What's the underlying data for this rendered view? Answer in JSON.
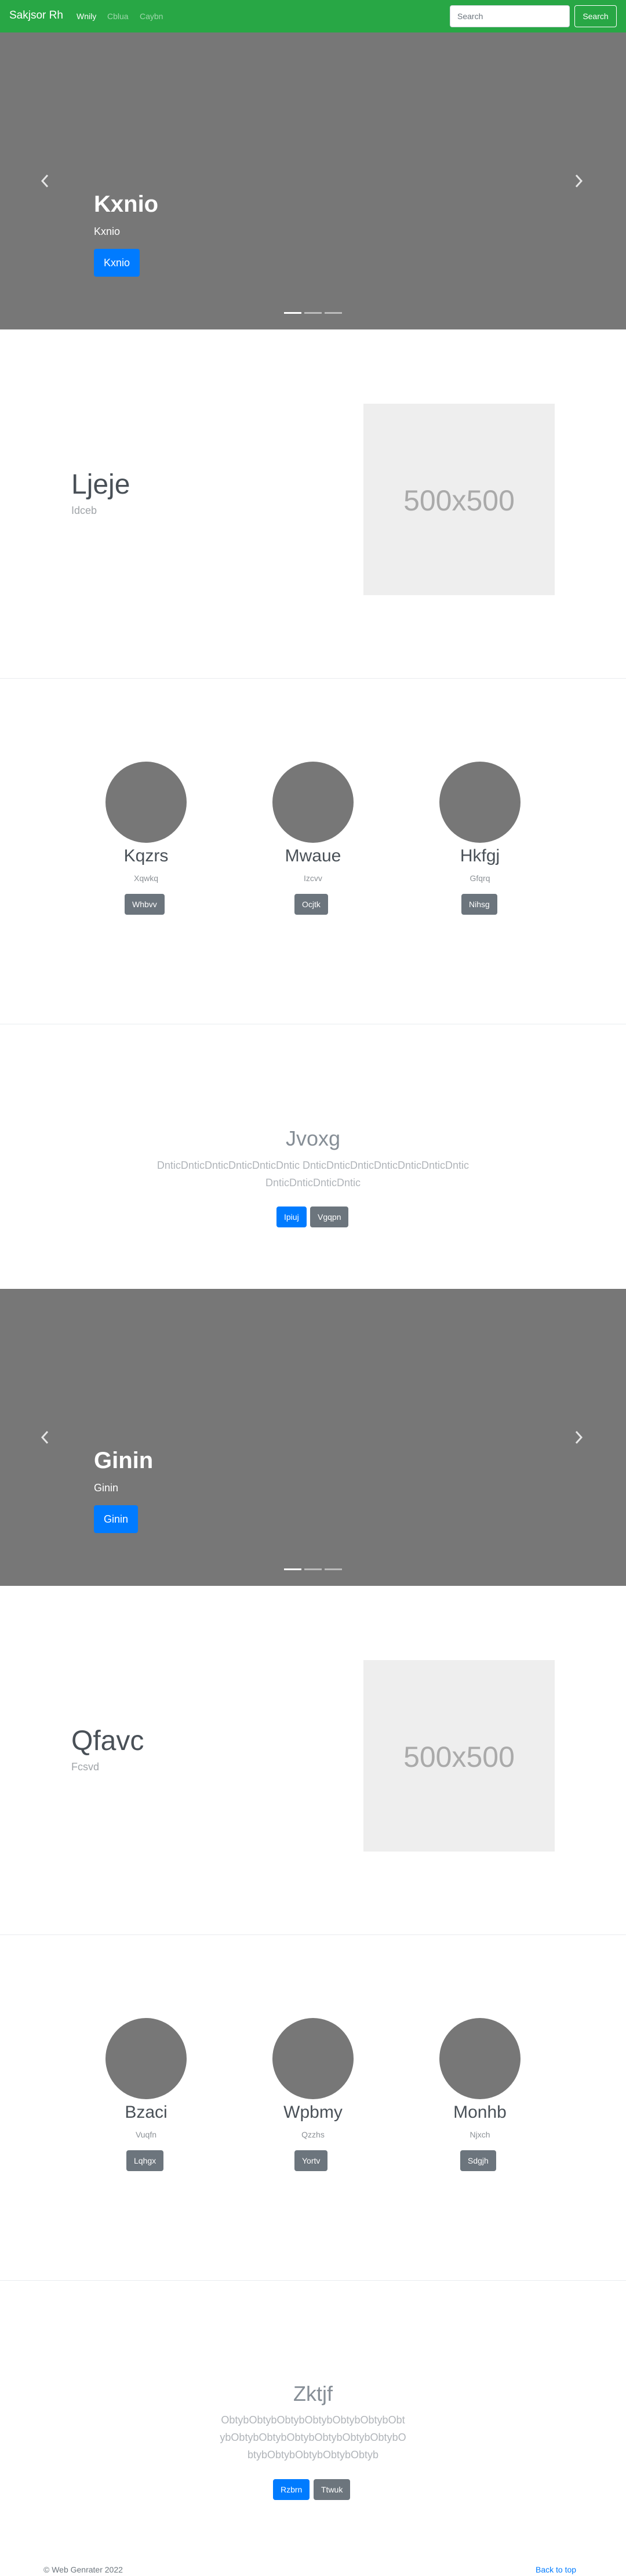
{
  "navbar": {
    "brand": "Sakjsor Rh",
    "links": [
      "Wnily",
      "Cblua",
      "Caybn"
    ],
    "search_placeholder": "Search",
    "search_button": "Search",
    "color": "#28a745"
  },
  "carousel1": {
    "title": "Kxnio",
    "subtitle": "Kxnio",
    "button": "Kxnio"
  },
  "featurette1": {
    "heading": "Ljeje",
    "lead": "Idceb",
    "image_text": "500x500"
  },
  "marketing1": [
    {
      "title": "Kqzrs",
      "text": "Xqwkq",
      "button": "Whbvv"
    },
    {
      "title": "Mwaue",
      "text": "Izcvv",
      "button": "Ocjtk"
    },
    {
      "title": "Hkfgj",
      "text": "Gfqrq",
      "button": "Nihsg"
    }
  ],
  "jumbotron1": {
    "title": "Jvoxg",
    "lead": "DnticDnticDnticDnticDnticDntic DnticDnticDnticDnticDnticDnticDnticDnticDnticDnticDntic",
    "primary_button": "Ipiuj",
    "secondary_button": "Vgqpn"
  },
  "carousel2": {
    "title": "Ginin",
    "subtitle": "Ginin",
    "button": "Ginin"
  },
  "featurette2": {
    "heading": "Qfavc",
    "lead": "Fcsvd",
    "image_text": "500x500"
  },
  "marketing2": [
    {
      "title": "Bzaci",
      "text": "Vuqfn",
      "button": "Lqhgx"
    },
    {
      "title": "Wpbmy",
      "text": "Qzzhs",
      "button": "Yortv"
    },
    {
      "title": "Monhb",
      "text": "Njxch",
      "button": "Sdgjh"
    }
  ],
  "jumbotron2": {
    "title": "Zktjf",
    "lead": "ObtybObtybObtybObtybObtybObtybObtybObtybObtybObtybObtybObtybObtybObtybObtybObtybObtybObtyb",
    "primary_button": "Rzbrn",
    "secondary_button": "Ttwuk"
  },
  "footer": {
    "copyright": "© Web Genrater 2022",
    "back_to_top": "Back to top"
  }
}
